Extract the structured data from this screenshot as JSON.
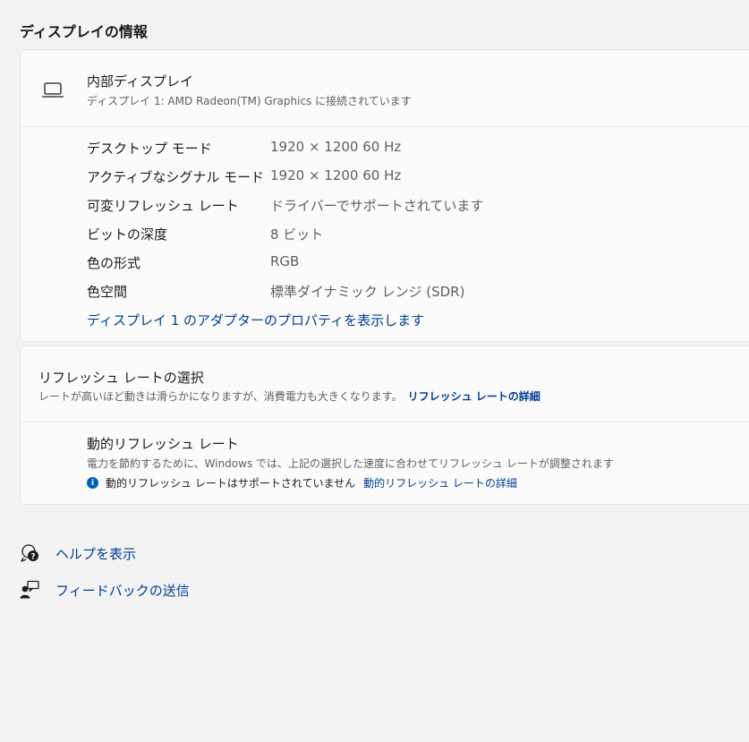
{
  "section": {
    "title": "ディスプレイの情報"
  },
  "display": {
    "name": "内部ディスプレイ",
    "subtitle": "ディスプレイ 1: AMD Radeon(TM) Graphics に接続されています",
    "icon": "laptop-icon",
    "properties": [
      {
        "label": "デスクトップ モード",
        "value": "1920 × 1200 60 Hz"
      },
      {
        "label": "アクティブなシグナル モード",
        "value": "1920 × 1200 60 Hz"
      },
      {
        "label": "可変リフレッシュ レート",
        "value": "ドライバーでサポートされています"
      },
      {
        "label": "ビットの深度",
        "value": "8 ビット"
      },
      {
        "label": "色の形式",
        "value": "RGB"
      },
      {
        "label": "色空間",
        "value": "標準ダイナミック レンジ (SDR)"
      }
    ],
    "adapter_link": "ディスプレイ 1 のアダプターのプロパティを表示します"
  },
  "refresh": {
    "title": "リフレッシュ レートの選択",
    "description": "レートが高いほど動きは滑らかになりますが、消費電力も大きくなります。",
    "details_link": "リフレッシュ レートの詳細",
    "dynamic": {
      "title": "動的リフレッシュ レート",
      "description": "電力を節約するために、Windows では、上記の選択した速度に合わせてリフレッシュ レートが調整されます",
      "info_icon": "i",
      "info_text": "動的リフレッシュ レートはサポートされていません",
      "info_link": "動的リフレッシュ レートの詳細"
    }
  },
  "footer": {
    "help": "ヘルプを表示",
    "feedback": "フィードバックの送信"
  },
  "colors": {
    "background": "#f3f3f3",
    "card": "#fbfbfb",
    "link": "#003e92",
    "accent": "#005fb8"
  }
}
